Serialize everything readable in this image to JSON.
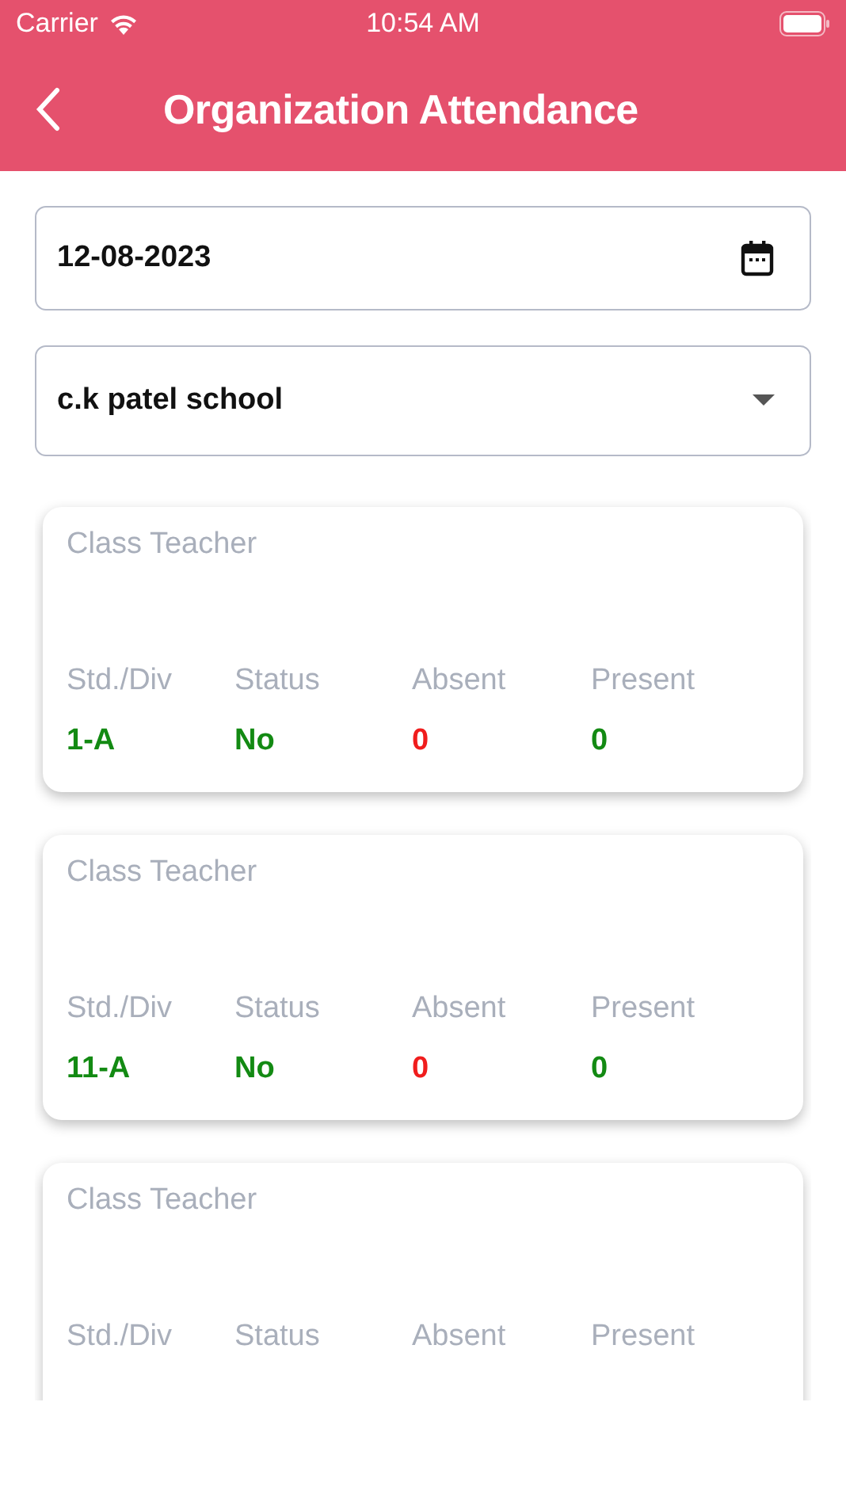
{
  "status_bar": {
    "carrier": "Carrier",
    "time": "10:54 AM"
  },
  "header": {
    "title": "Organization Attendance"
  },
  "date_field": {
    "value": "12-08-2023"
  },
  "school_dropdown": {
    "value": "c.k patel school"
  },
  "cards": [
    {
      "title": "Class Teacher",
      "cells": [
        {
          "label": "Std./Div",
          "value": "1-A",
          "color": "#138a13"
        },
        {
          "label": "Status",
          "value": "No",
          "color": "#138a13"
        },
        {
          "label": "Absent",
          "value": "0",
          "color": "#f01d1d"
        },
        {
          "label": "Present",
          "value": "0",
          "color": "#138a13"
        }
      ]
    },
    {
      "title": "Class Teacher",
      "cells": [
        {
          "label": "Std./Div",
          "value": "11-A",
          "color": "#138a13"
        },
        {
          "label": "Status",
          "value": "No",
          "color": "#138a13"
        },
        {
          "label": "Absent",
          "value": "0",
          "color": "#f01d1d"
        },
        {
          "label": "Present",
          "value": "0",
          "color": "#138a13"
        }
      ]
    },
    {
      "title": "Class Teacher",
      "cells": [
        {
          "label": "Std./Div"
        },
        {
          "label": "Status"
        },
        {
          "label": "Absent"
        },
        {
          "label": "Present"
        }
      ]
    }
  ]
}
